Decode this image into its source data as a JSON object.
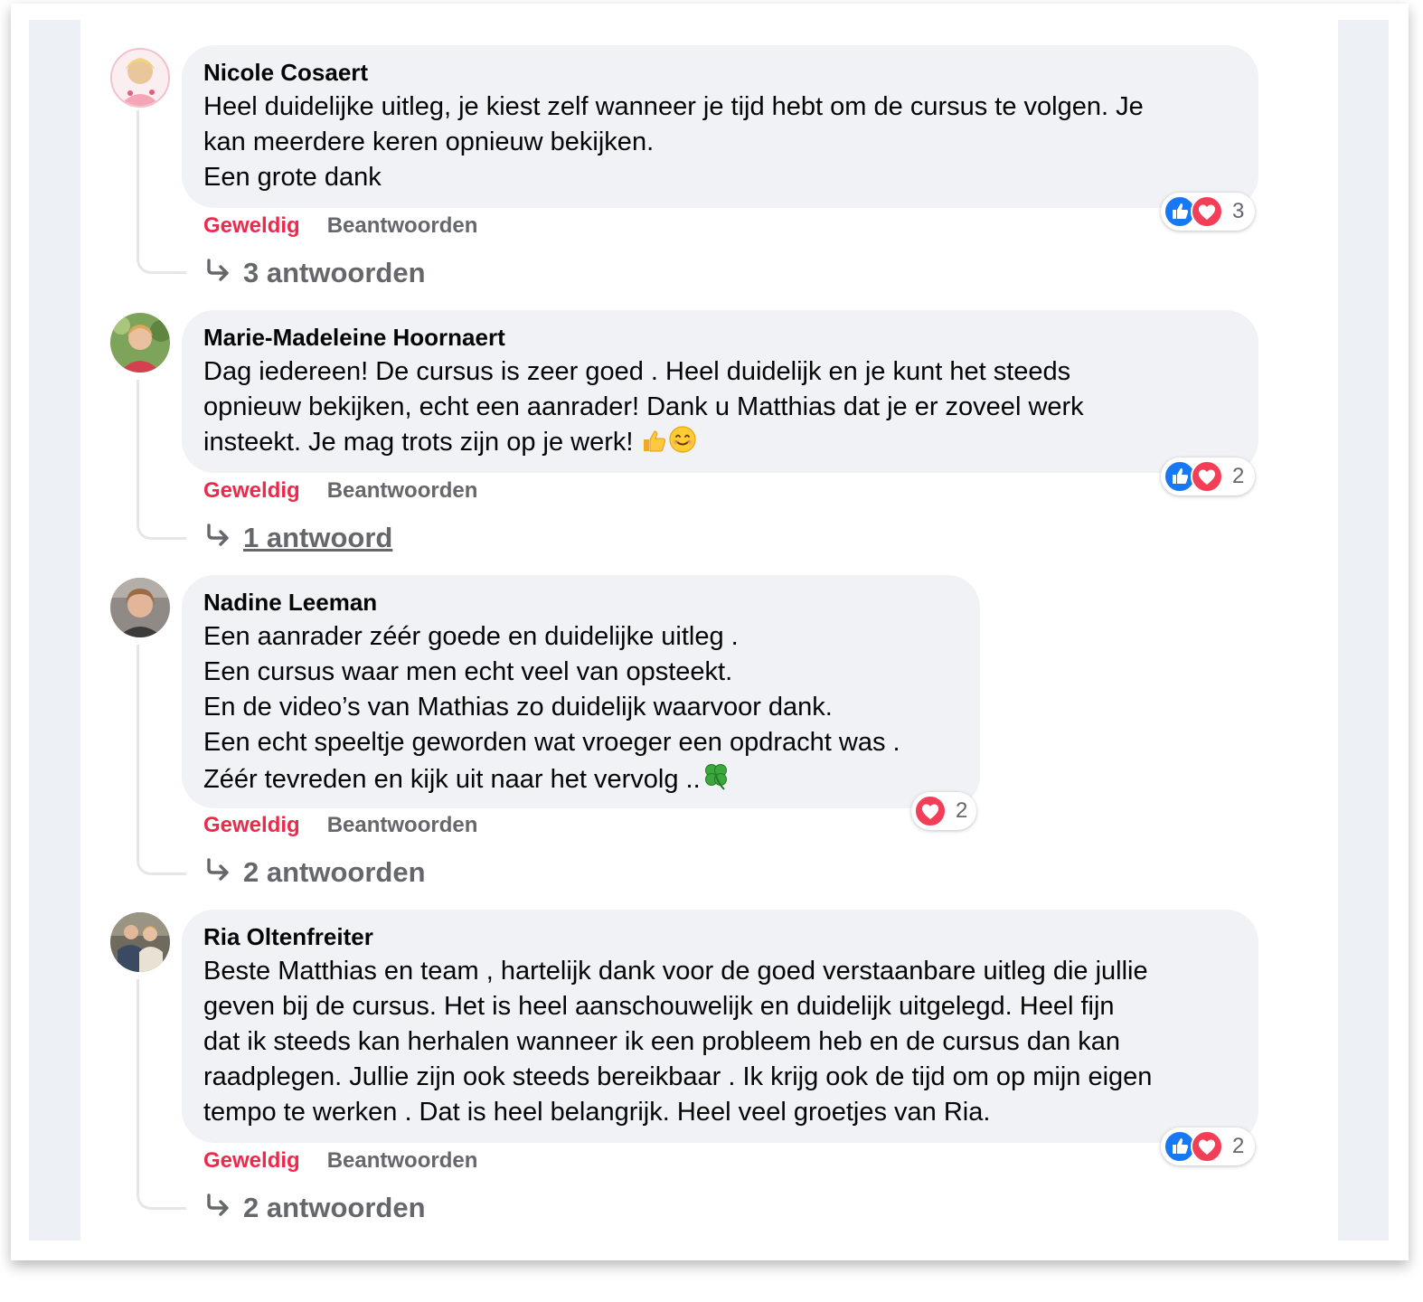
{
  "comments": [
    {
      "author": "Nicole Cosaert",
      "lines": [
        "Heel duidelijke uitleg, je kiest zelf wanneer je tijd hebt om de cursus te volgen. Je",
        "kan meerdere keren opnieuw bekijken.",
        "Een grote dank"
      ],
      "like_label": "Geweldig",
      "reply_label": "Beantwoorden",
      "reaction_icons": [
        "like-icon",
        "love-icon"
      ],
      "reaction_count": "3",
      "replies_label": "3 antwoorden"
    },
    {
      "author": "Marie-Madeleine Hoornaert",
      "lines": [
        "Dag iedereen! De cursus is zeer goed . Heel duidelijk en je kunt het steeds",
        "opnieuw bekijken, echt een aanrader! Dank u Matthias dat je er zoveel werk",
        "insteekt. Je mag trots zijn op je werk!"
      ],
      "trailing_emoji": [
        "thumbs-up-emoji",
        "smiling-face-emoji"
      ],
      "like_label": "Geweldig",
      "reply_label": "Beantwoorden",
      "reaction_icons": [
        "like-icon",
        "love-icon"
      ],
      "reaction_count": "2",
      "replies_label": "1 antwoord"
    },
    {
      "author": "Nadine Leeman",
      "lines": [
        "Een aanrader zéér goede en duidelijke uitleg .",
        "Een cursus waar men echt veel van opsteekt.",
        "En de video’s van Mathias zo duidelijk waarvoor dank.",
        "Een echt speeltje geworden wat vroeger een opdracht was .",
        "Zéér tevreden en kijk uit naar het vervolg .."
      ],
      "trailing_emoji": [
        "four-leaf-clover-emoji"
      ],
      "like_label": "Geweldig",
      "reply_label": "Beantwoorden",
      "reaction_icons": [
        "love-icon"
      ],
      "reaction_count": "2",
      "replies_label": "2 antwoorden"
    },
    {
      "author": "Ria Oltenfreiter",
      "lines": [
        "Beste Matthias en team , hartelijk dank voor de goed verstaanbare uitleg die jullie",
        "geven bij de cursus. Het is heel aanschouwelijk en duidelijk uitgelegd. Heel fijn",
        "dat ik steeds kan herhalen wanneer ik een probleem heb en de cursus dan kan",
        "raadplegen. Jullie zijn ook steeds bereikbaar . Ik krijg ook de tijd om op mijn eigen",
        "tempo te werken . Dat is heel belangrijk. Heel veel groetjes van Ria."
      ],
      "like_label": "Geweldig",
      "reply_label": "Beantwoorden",
      "reaction_icons": [
        "like-icon",
        "love-icon"
      ],
      "reaction_count": "2",
      "replies_label": "2 antwoorden"
    }
  ],
  "colors": {
    "like_active": "#f0284a",
    "muted": "#65676b",
    "bubble": "#f0f2f5",
    "like_blue": "#1877f2",
    "love_red": "#f33e58"
  }
}
